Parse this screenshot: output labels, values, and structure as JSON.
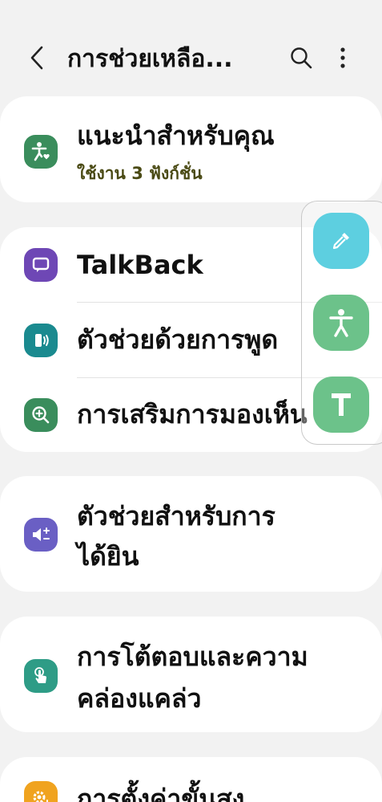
{
  "header": {
    "title": "การช่วยเหลือ...",
    "back_icon": "chevron-left-icon",
    "search_icon": "search-icon",
    "more_icon": "more-vertical-icon"
  },
  "colors": {
    "background": "#f2f2f2",
    "card": "#ffffff",
    "green_icon": "#3a8d5c",
    "purple_icon": "#6e47b5",
    "teal_icon": "#1a8a8f",
    "violet_icon": "#6a5fc4",
    "accent_teal": "#2e9c86",
    "orange_icon": "#f0a31f",
    "float_cyan": "#5dcfe0",
    "float_green": "#6cc28a"
  },
  "cards": {
    "recommended": {
      "title": "แนะนำสำหรับคุณ",
      "subtitle": "ใช้งาน 3 ฟังก์ชั่น",
      "icon": "accessibility-heart-icon"
    },
    "vision": {
      "items": [
        {
          "label": "TalkBack",
          "icon": "talkback-icon"
        },
        {
          "label": "ตัวช่วยด้วยการพูด",
          "icon": "speech-assist-icon"
        },
        {
          "label": "การเสริมการมองเห็น",
          "icon": "zoom-in-icon"
        }
      ]
    },
    "hearing": {
      "line1": "ตัวช่วยสำหรับการ",
      "line2": "ได้ยิน",
      "icon": "volume-plus-icon"
    },
    "interaction": {
      "line1": "การโต้ตอบและความ",
      "line2": "คล่องแคล่ว",
      "icon": "hand-touch-icon"
    },
    "advanced": {
      "label": "การตั้งค่าขั้นสูง",
      "icon": "gear-plus-icon"
    }
  },
  "floating_menu": {
    "items": [
      {
        "icon": "eyedropper-icon"
      },
      {
        "icon": "accessibility-icon"
      },
      {
        "icon": "text-size-icon"
      }
    ]
  }
}
